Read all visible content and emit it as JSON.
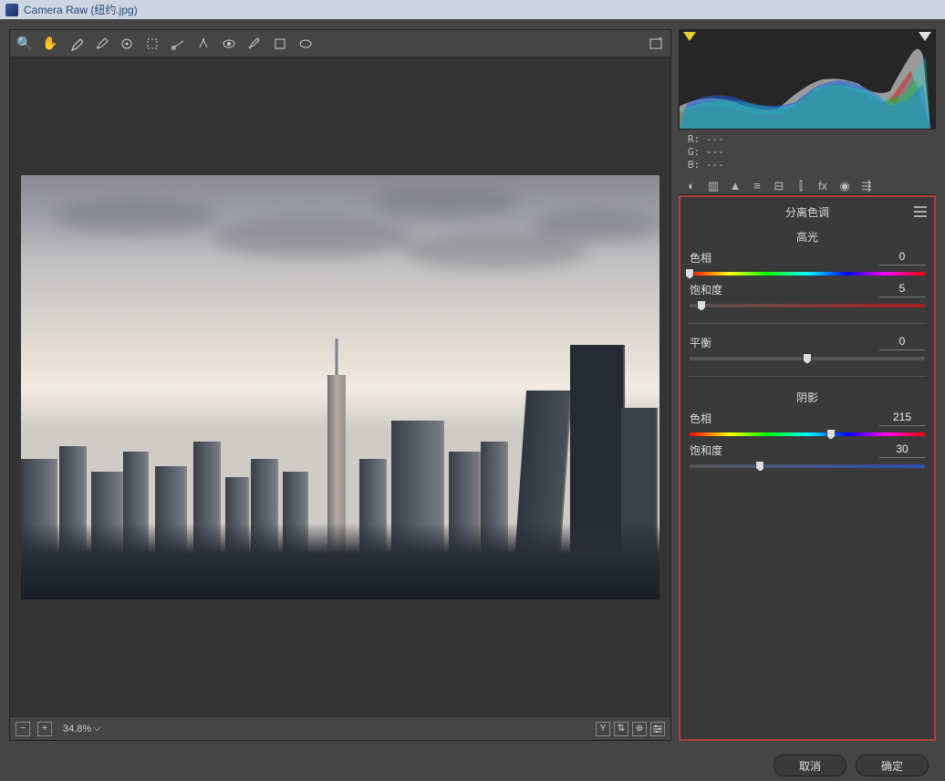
{
  "window": {
    "title": "Camera Raw (纽约.jpg)"
  },
  "toolbar": {
    "tools": [
      "zoom",
      "hand",
      "eyedropper",
      "sampler",
      "target",
      "crop",
      "straighten",
      "spot",
      "redeye",
      "brush",
      "radial",
      "rotate",
      "prefs"
    ]
  },
  "statusbar": {
    "minus": "−",
    "plus": "+",
    "zoom": "34.8%",
    "chevron": "⌵"
  },
  "rgb": {
    "r": "R:  ---",
    "g": "G:  ---",
    "b": "B:  ---"
  },
  "panel": {
    "title": "分离色调",
    "highlights": {
      "head": "高光",
      "hue_label": "色相",
      "hue_value": "0",
      "sat_label": "饱和度",
      "sat_value": "5"
    },
    "balance": {
      "label": "平衡",
      "value": "0"
    },
    "shadows": {
      "head": "阴影",
      "hue_label": "色相",
      "hue_value": "215",
      "sat_label": "饱和度",
      "sat_value": "30"
    }
  },
  "footer": {
    "cancel": "取消",
    "ok": "确定"
  }
}
